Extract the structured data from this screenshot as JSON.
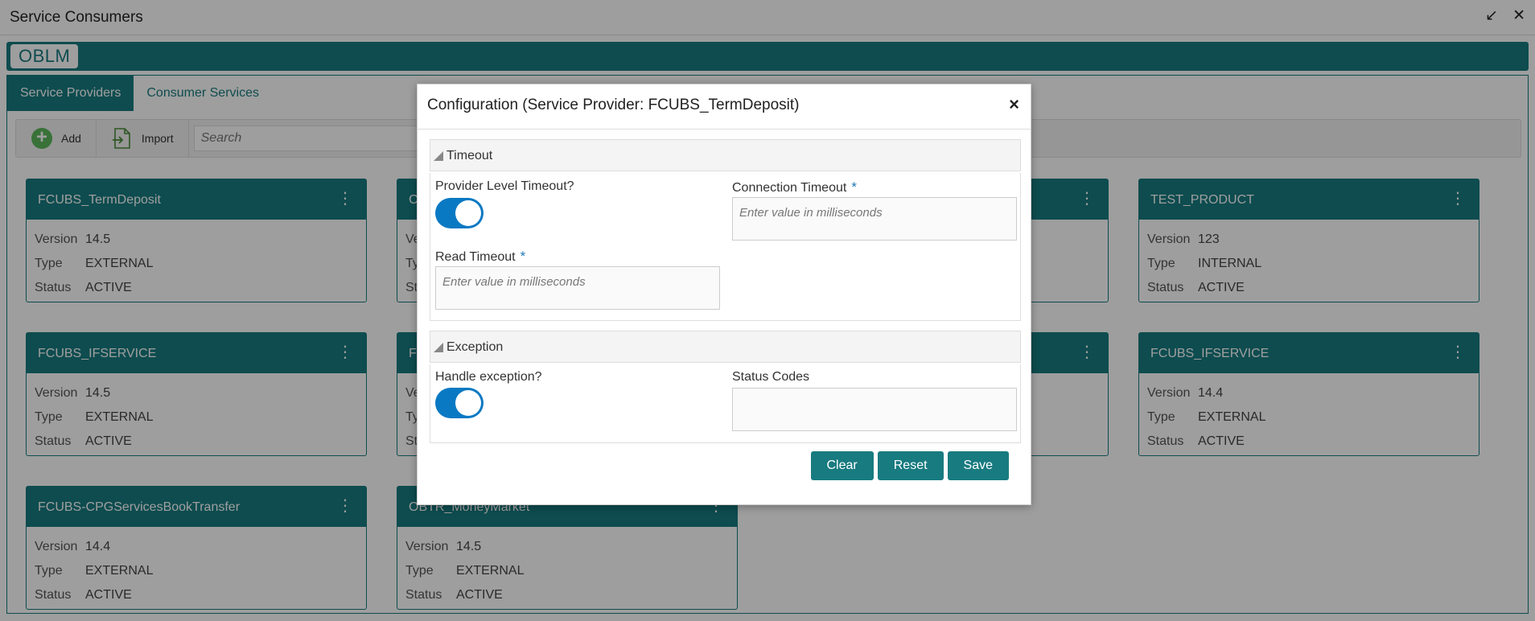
{
  "window": {
    "title": "Service Consumers",
    "minimize_icon": "↙",
    "close_icon": "✕"
  },
  "brand": {
    "logo": "OBLM"
  },
  "tabs": [
    {
      "label": "Service Providers",
      "active": true
    },
    {
      "label": "Consumer Services",
      "active": false
    }
  ],
  "toolbar": {
    "add_label": "Add",
    "import_label": "Import",
    "search_placeholder": "Search"
  },
  "cards": [
    {
      "name": "FCUBS_TermDeposit",
      "version": "14.5",
      "type": "EXTERNAL",
      "status": "ACTIVE"
    },
    {
      "name": "C",
      "version": "",
      "type": "",
      "status": ""
    },
    {
      "name": "",
      "version": "",
      "type": "",
      "status": ""
    },
    {
      "name": "TEST_PRODUCT",
      "version": "123",
      "type": "INTERNAL",
      "status": "ACTIVE"
    },
    {
      "name": "FCUBS_IFSERVICE",
      "version": "14.5",
      "type": "EXTERNAL",
      "status": "ACTIVE"
    },
    {
      "name": "F",
      "version": "",
      "type": "",
      "status": ""
    },
    {
      "name": "",
      "version": "",
      "type": "",
      "status": ""
    },
    {
      "name": "FCUBS_IFSERVICE",
      "version": "14.4",
      "type": "EXTERNAL",
      "status": "ACTIVE"
    },
    {
      "name": "FCUBS-CPGServicesBookTransfer",
      "version": "14.4",
      "type": "EXTERNAL",
      "status": "ACTIVE"
    },
    {
      "name": "OBTR_MoneyMarket",
      "version": "14.5",
      "type": "EXTERNAL",
      "status": "ACTIVE"
    }
  ],
  "card_labels": {
    "version": "Version",
    "type": "Type",
    "status": "Status",
    "menu_icon": "⋮"
  },
  "modal": {
    "title": "Configuration (Service Provider: FCUBS_TermDeposit)",
    "close": "×",
    "timeout_section": {
      "title": "Timeout",
      "provider_level_label": "Provider Level Timeout?",
      "provider_level_on": true,
      "connection_timeout_label": "Connection Timeout",
      "connection_timeout_placeholder": "Enter value in milliseconds",
      "read_timeout_label": "Read Timeout",
      "read_timeout_placeholder": "Enter value in milliseconds",
      "required_mark": "*"
    },
    "exception_section": {
      "title": "Exception",
      "handle_exception_label": "Handle exception?",
      "handle_exception_on": true,
      "status_codes_label": "Status Codes",
      "status_codes_value": ""
    },
    "buttons": {
      "clear": "Clear",
      "reset": "Reset",
      "save": "Save"
    }
  },
  "colors": {
    "teal": "#187b80",
    "toggle_blue": "#0a79c3",
    "required_blue": "#1f77b4"
  }
}
